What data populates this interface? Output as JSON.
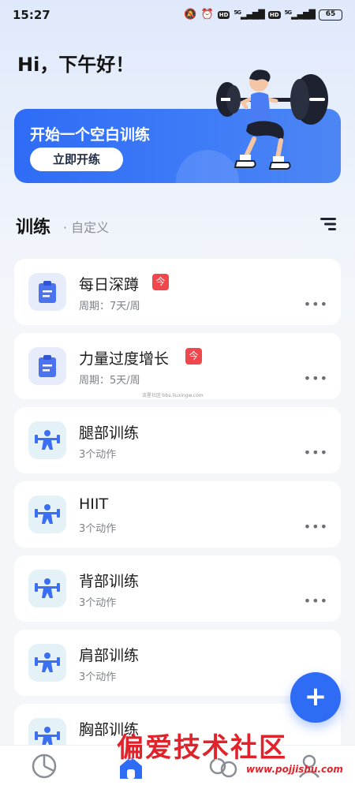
{
  "status": {
    "time": "15:27",
    "net1": "5G",
    "net2": "5G",
    "hd1": "HD",
    "hd2": "HD",
    "battery": "65"
  },
  "greeting": "Hi，下午好！",
  "banner": {
    "title": "开始一个空白训练",
    "button": "立即开练"
  },
  "section": {
    "title": "训练",
    "subtitle": "· 自定义"
  },
  "workouts": [
    {
      "title": "每日深蹲",
      "subtitle": "周期：7天/周",
      "badge": "今",
      "icon": "clipboard-icon"
    },
    {
      "title": "力量过度增长",
      "subtitle": "周期：5天/周",
      "badge": "今",
      "icon": "clipboard-icon"
    },
    {
      "title": "腿部训练",
      "subtitle": "3个动作",
      "icon": "weightlifter-icon"
    },
    {
      "title": "HIIT",
      "subtitle": "3个动作",
      "icon": "weightlifter-icon"
    },
    {
      "title": "背部训练",
      "subtitle": "3个动作",
      "icon": "weightlifter-icon"
    },
    {
      "title": "肩部训练",
      "subtitle": "3个动作",
      "icon": "weightlifter-icon"
    },
    {
      "title": "胸部训练",
      "subtitle": "",
      "icon": "weightlifter-icon"
    }
  ],
  "more_label": "•••",
  "fab_label": "+",
  "watermark_small": "流星社区·bbs.liuxingw.com",
  "watermark": "偏爱技术社区",
  "watermark_url": "www.pojjishu.com",
  "colors": {
    "accent": "#2e6cf5",
    "badge": "#f0474c",
    "background": "#f4f6fa"
  }
}
